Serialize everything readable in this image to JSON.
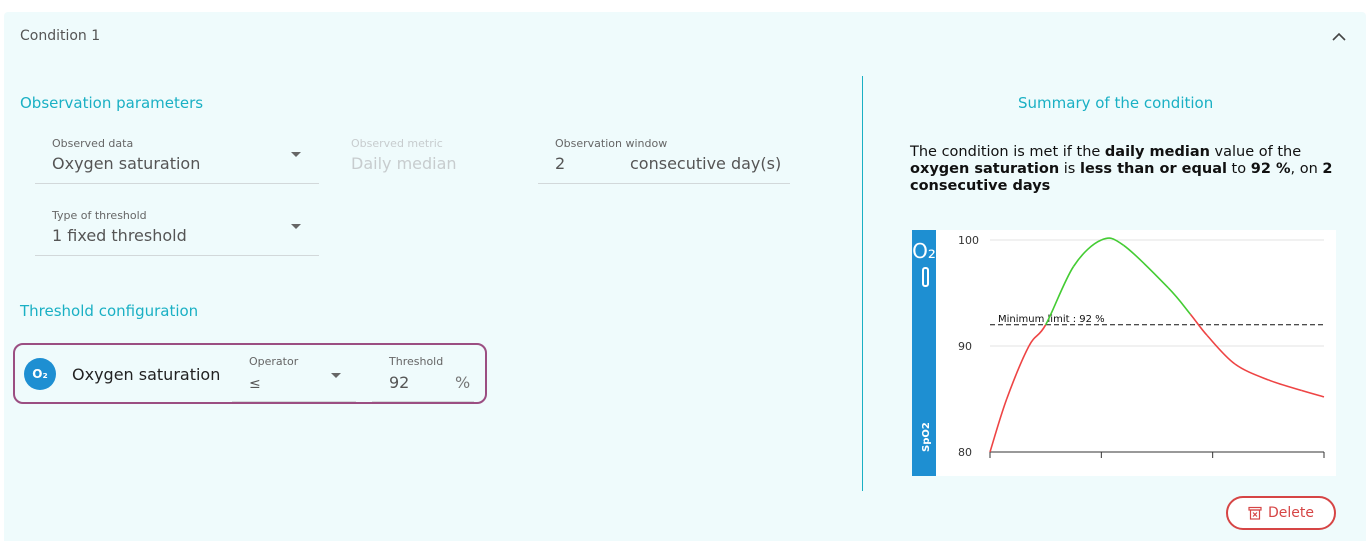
{
  "condition": {
    "title": "Condition 1"
  },
  "observation": {
    "section_title": "Observation parameters",
    "observed_data": {
      "label": "Observed data",
      "value": "Oxygen saturation"
    },
    "observed_metric": {
      "label": "Observed metric",
      "value": "Daily median"
    },
    "observation_window": {
      "label": "Observation window",
      "value": "2",
      "unit": "consecutive day(s)"
    },
    "threshold_type": {
      "label": "Type of threshold",
      "value": "1 fixed threshold"
    }
  },
  "threshold_config": {
    "section_title": "Threshold configuration",
    "badge": "O₂",
    "name": "Oxygen saturation",
    "operator_label": "Operator",
    "operator_value": "≤",
    "threshold_label": "Threshold",
    "threshold_value": "92",
    "threshold_unit": "%"
  },
  "summary": {
    "title": "Summary of the condition",
    "parts": [
      {
        "text": "The condition is met if the ",
        "bold": false
      },
      {
        "text": "daily median",
        "bold": true
      },
      {
        "text": " value of the ",
        "bold": false
      },
      {
        "text": "oxygen saturation",
        "bold": true
      },
      {
        "text": " is ",
        "bold": false
      },
      {
        "text": "less than or equal",
        "bold": true
      },
      {
        "text": " to ",
        "bold": false
      },
      {
        "text": "92 %",
        "bold": true
      },
      {
        "text": ", on ",
        "bold": false
      },
      {
        "text": "2 consecutive days",
        "bold": true
      }
    ]
  },
  "chart_data": {
    "type": "line",
    "sidebar_symbol": "O₂",
    "sidebar_label": "SpO2",
    "ylim": [
      80,
      100
    ],
    "y_ticks": [
      80,
      90,
      100
    ],
    "threshold": {
      "value": 92,
      "label": "Minimum limit : 92 %"
    },
    "points": [
      {
        "x": 0,
        "y": 80
      },
      {
        "x": 0.15,
        "y": 85
      },
      {
        "x": 0.35,
        "y": 90
      },
      {
        "x": 0.5,
        "y": 92
      },
      {
        "x": 0.75,
        "y": 97.5
      },
      {
        "x": 1.0,
        "y": 100
      },
      {
        "x": 1.2,
        "y": 99.5
      },
      {
        "x": 1.6,
        "y": 95.5
      },
      {
        "x": 1.8,
        "y": 93
      },
      {
        "x": 1.95,
        "y": 91
      },
      {
        "x": 2.2,
        "y": 88.3
      },
      {
        "x": 2.5,
        "y": 86.8
      },
      {
        "x": 2.8,
        "y": 85.8
      },
      {
        "x": 3.0,
        "y": 85.2
      }
    ],
    "colors": {
      "above": "#44cc33",
      "below": "#ee4444",
      "axis_bar": "#1e8fd2",
      "threshold": "#111111"
    }
  },
  "actions": {
    "delete_label": "Delete"
  },
  "colors": {
    "accent": "#1ab0c4",
    "highlight_border": "#9b4e82",
    "danger": "#d64545"
  }
}
